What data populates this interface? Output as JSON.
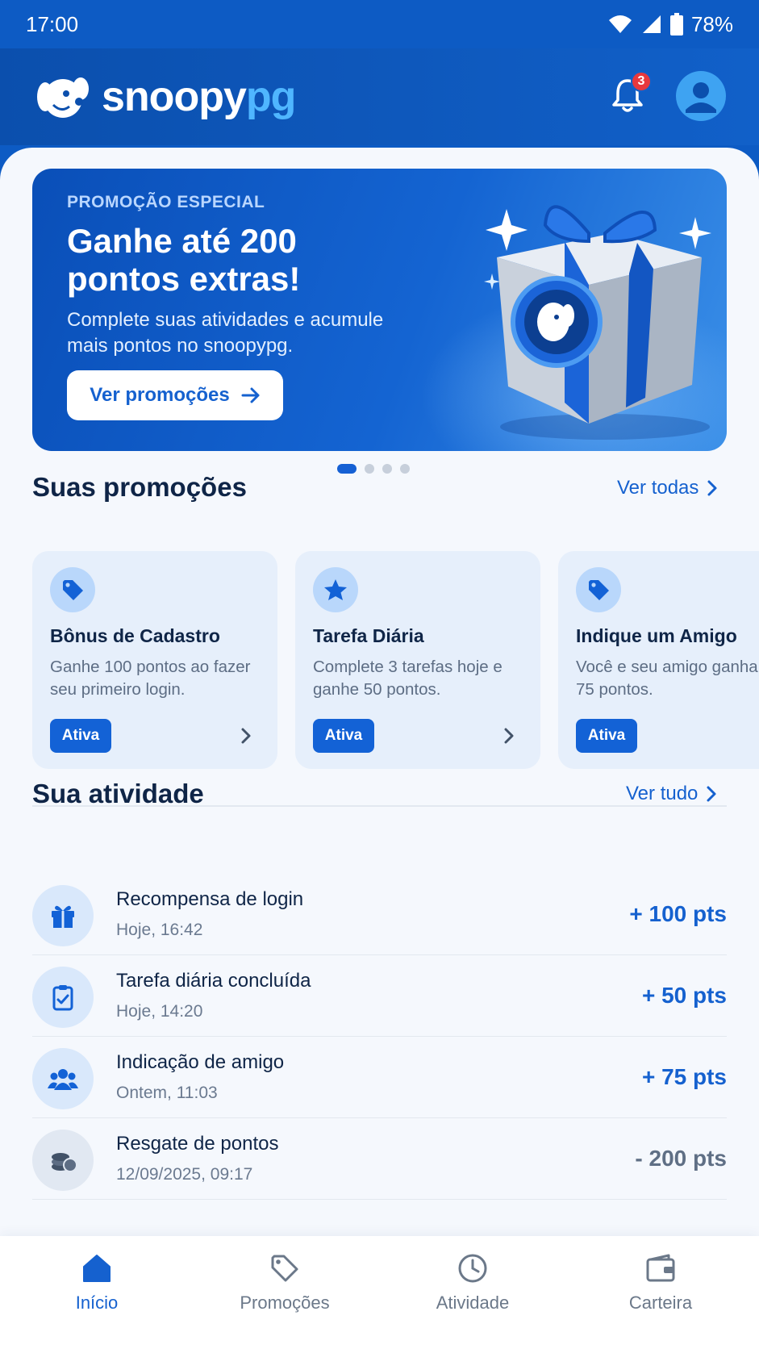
{
  "status": {
    "time": "17:00",
    "battery": "78%"
  },
  "header": {
    "logo_main": "snoopy",
    "logo_accent": "pg",
    "notification_count": "3"
  },
  "hero": {
    "kicker": "PROMOÇÃO ESPECIAL",
    "title": "Ganhe até 200 pontos extras!",
    "subtitle": "Complete suas atividades e acumule mais pontos no snoopypg.",
    "button": "Ver promoções",
    "carousel_total": 4,
    "carousel_active": 1
  },
  "promotions": {
    "title": "Suas promoções",
    "link": "Ver todas",
    "cards": [
      {
        "icon": "tag-icon",
        "title": "Bônus de Cadastro",
        "desc": "Ganhe 100 pontos ao fazer seu primeiro login.",
        "status": "Ativa"
      },
      {
        "icon": "star-icon",
        "title": "Tarefa Diária",
        "desc": "Complete 3 tarefas hoje e ganhe 50 pontos.",
        "status": "Ativa"
      },
      {
        "icon": "tag-icon",
        "title": "Indique um Amigo",
        "desc": "Você e seu amigo ganham 75 pontos.",
        "status": "Ativa"
      }
    ]
  },
  "activity": {
    "title": "Sua atividade",
    "link": "Ver tudo",
    "items": [
      {
        "icon": "gift-icon",
        "title": "Recompensa de login",
        "date": "Hoje, 16:42",
        "points": "+ 100 pts"
      },
      {
        "icon": "clipboard-check-icon",
        "title": "Tarefa diária concluída",
        "date": "Hoje, 14:20",
        "points": "+ 50 pts"
      },
      {
        "icon": "users-icon",
        "title": "Indicação de amigo",
        "date": "Ontem, 11:03",
        "points": "+ 75 pts"
      },
      {
        "icon": "coins-icon",
        "title": "Resgate de pontos",
        "date": "12/09/2025, 09:17",
        "points": "- 200 pts"
      }
    ]
  },
  "nav": {
    "items": [
      {
        "label": "Início",
        "icon": "home-icon",
        "active": true
      },
      {
        "label": "Promoções",
        "icon": "tag-icon",
        "active": false
      },
      {
        "label": "Atividade",
        "icon": "clock-icon",
        "active": false
      },
      {
        "label": "Carteira",
        "icon": "wallet-icon",
        "active": false
      }
    ]
  },
  "colors": {
    "primary": "#1561cf",
    "header": "#0d5bc4",
    "badge": "#e8383d"
  }
}
